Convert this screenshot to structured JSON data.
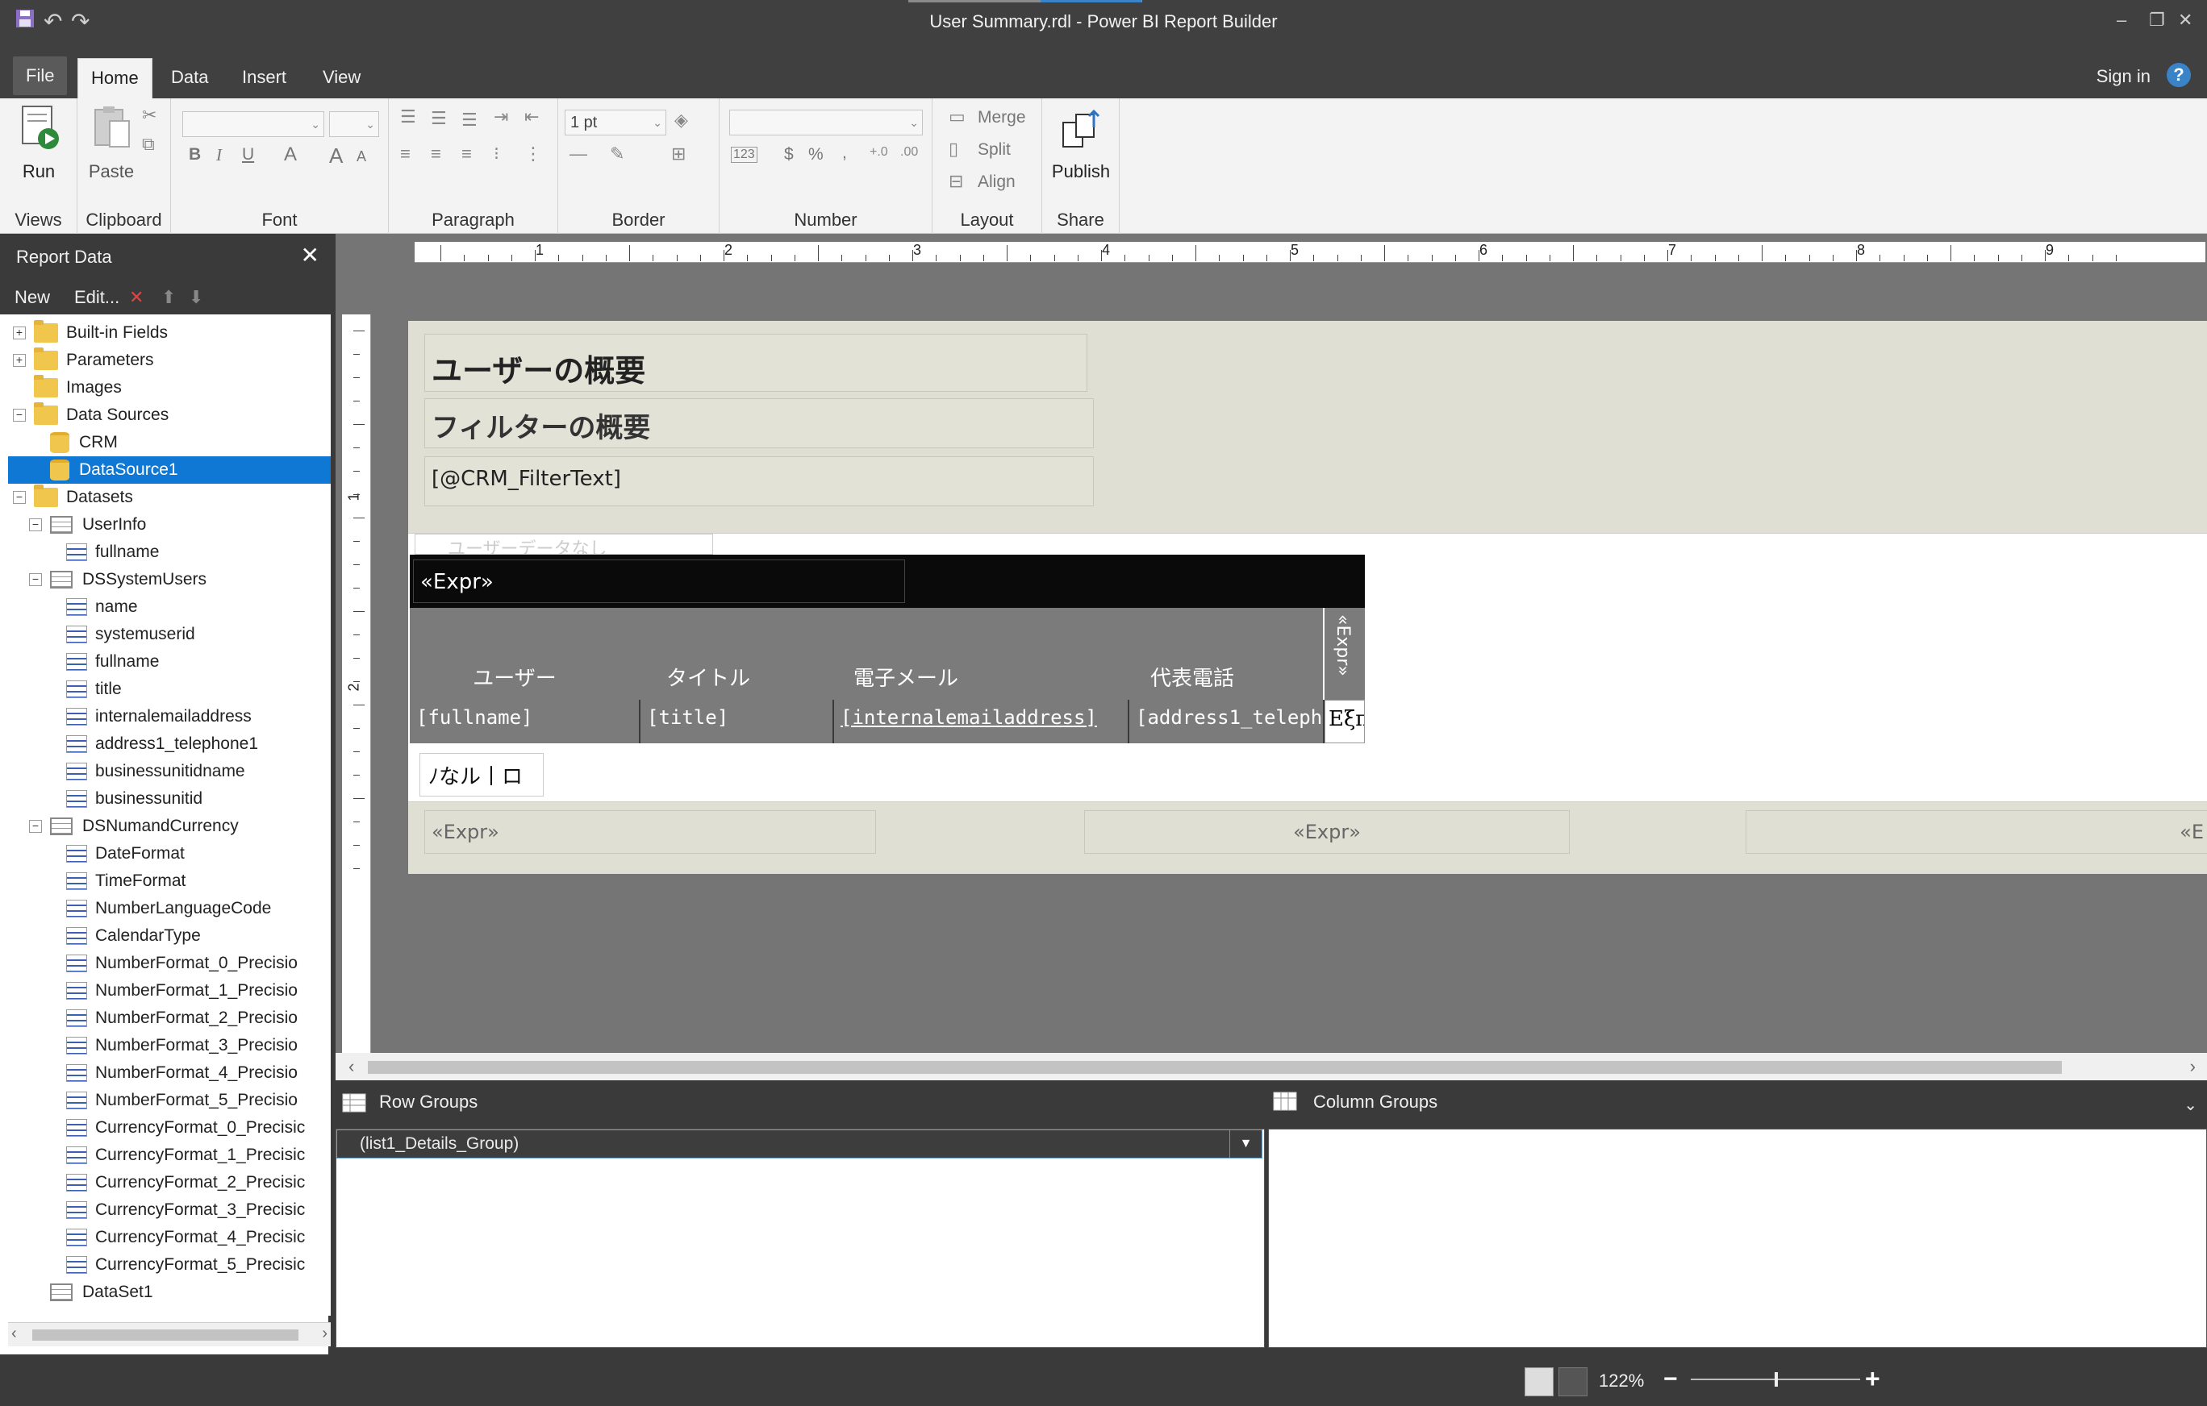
{
  "window": {
    "title": "User Summary.rdl - Power BI Report Builder",
    "minimize": "–",
    "restore": "❐",
    "close": "✕",
    "undo": "↶",
    "redo": "↷"
  },
  "ribbon_tabs": [
    "File",
    "Home",
    "Data",
    "Insert",
    "View"
  ],
  "signin": "Sign in",
  "help": "?",
  "ribbon": {
    "run": "Run",
    "paste": "Paste",
    "views": "Views",
    "clipboard": "Clipboard",
    "font": "Font",
    "paragraph": "Paragraph",
    "border": "Border",
    "number": "Number",
    "layout": "Layout",
    "share": "Share",
    "border_width": "1 pt",
    "merge": "Merge",
    "split": "Split",
    "align": "Align",
    "publish": "Publish",
    "bold": "B",
    "italic": "I",
    "underline": "U",
    "currency": "$",
    "percent": "%",
    "comma": ",",
    "grow": "A",
    "num_fmt": "123"
  },
  "report_data": {
    "title": "Report Data",
    "close": "✕",
    "toolbar": {
      "new": "New",
      "edit": "Edit...",
      "delete": "✕",
      "up": "⬆",
      "down": "⬇"
    },
    "tree": [
      {
        "label": "Built-in Fields",
        "icon": "folder-icon",
        "level": 0,
        "exp": "+"
      },
      {
        "label": "Parameters",
        "icon": "folder-icon",
        "level": 0,
        "exp": "+"
      },
      {
        "label": "Images",
        "icon": "folder-icon",
        "level": 0,
        "exp": ""
      },
      {
        "label": "Data Sources",
        "icon": "folder-open-icon",
        "level": 0,
        "exp": "−"
      },
      {
        "label": "CRM",
        "icon": "datasource-icon",
        "level": 1,
        "exp": ""
      },
      {
        "label": "DataSource1",
        "icon": "datasource-icon",
        "level": 1,
        "exp": "",
        "selected": true
      },
      {
        "label": "Datasets",
        "icon": "folder-open-icon",
        "level": 0,
        "exp": "−"
      },
      {
        "label": "UserInfo",
        "icon": "dataset-icon",
        "level": 1,
        "exp": "−"
      },
      {
        "label": "fullname",
        "icon": "field-icon",
        "level": 2,
        "exp": ""
      },
      {
        "label": "DSSystemUsers",
        "icon": "dataset-icon",
        "level": 1,
        "exp": "−"
      },
      {
        "label": "name",
        "icon": "field-icon",
        "level": 2,
        "exp": ""
      },
      {
        "label": "systemuserid",
        "icon": "field-icon",
        "level": 2,
        "exp": ""
      },
      {
        "label": "fullname",
        "icon": "field-icon",
        "level": 2,
        "exp": ""
      },
      {
        "label": "title",
        "icon": "field-icon",
        "level": 2,
        "exp": ""
      },
      {
        "label": "internalemailaddress",
        "icon": "field-icon",
        "level": 2,
        "exp": ""
      },
      {
        "label": "address1_telephone1",
        "icon": "field-icon",
        "level": 2,
        "exp": ""
      },
      {
        "label": "businessunitidname",
        "icon": "field-icon",
        "level": 2,
        "exp": ""
      },
      {
        "label": "businessunitid",
        "icon": "field-icon",
        "level": 2,
        "exp": ""
      },
      {
        "label": "DSNumandCurrency",
        "icon": "dataset-icon",
        "level": 1,
        "exp": "−"
      },
      {
        "label": "DateFormat",
        "icon": "field-icon",
        "level": 2,
        "exp": ""
      },
      {
        "label": "TimeFormat",
        "icon": "field-icon",
        "level": 2,
        "exp": ""
      },
      {
        "label": "NumberLanguageCode",
        "icon": "field-icon",
        "level": 2,
        "exp": ""
      },
      {
        "label": "CalendarType",
        "icon": "field-icon",
        "level": 2,
        "exp": ""
      },
      {
        "label": "NumberFormat_0_Precisio",
        "icon": "field-icon",
        "level": 2,
        "exp": ""
      },
      {
        "label": "NumberFormat_1_Precisio",
        "icon": "field-icon",
        "level": 2,
        "exp": ""
      },
      {
        "label": "NumberFormat_2_Precisio",
        "icon": "field-icon",
        "level": 2,
        "exp": ""
      },
      {
        "label": "NumberFormat_3_Precisio",
        "icon": "field-icon",
        "level": 2,
        "exp": ""
      },
      {
        "label": "NumberFormat_4_Precisio",
        "icon": "field-icon",
        "level": 2,
        "exp": ""
      },
      {
        "label": "NumberFormat_5_Precisio",
        "icon": "field-icon",
        "level": 2,
        "exp": ""
      },
      {
        "label": "CurrencyFormat_0_Precisic",
        "icon": "field-icon",
        "level": 2,
        "exp": ""
      },
      {
        "label": "CurrencyFormat_1_Precisic",
        "icon": "field-icon",
        "level": 2,
        "exp": ""
      },
      {
        "label": "CurrencyFormat_2_Precisic",
        "icon": "field-icon",
        "level": 2,
        "exp": ""
      },
      {
        "label": "CurrencyFormat_3_Precisic",
        "icon": "field-icon",
        "level": 2,
        "exp": ""
      },
      {
        "label": "CurrencyFormat_4_Precisic",
        "icon": "field-icon",
        "level": 2,
        "exp": ""
      },
      {
        "label": "CurrencyFormat_5_Precisic",
        "icon": "field-icon",
        "level": 2,
        "exp": ""
      },
      {
        "label": "DataSet1",
        "icon": "dataset-icon",
        "level": 1,
        "exp": ""
      }
    ]
  },
  "ruler": {
    "h_numbers": [
      "1",
      "2",
      "3",
      "4",
      "5",
      "6",
      "7",
      "8",
      "9"
    ],
    "v_numbers": [
      "1",
      "2"
    ]
  },
  "report": {
    "title": "ユーザーの概要",
    "filter_title": "フィルターの概要",
    "filter_text": "[@CRM_FilterText]",
    "hidden_text": "ユーザーデータなし",
    "list_expr": "«Expr»",
    "col_headers": [
      "ユーザー",
      "タイトル",
      "電子メール",
      "代表電話"
    ],
    "vertical_expr": "«Expr»",
    "detail_cells": [
      "[fullname]",
      "[title]",
      "[internalemailaddress]",
      "[address1_teleph"
    ],
    "detail_last": "Eξπ",
    "jp_text": "ﾉなル丨ロ",
    "footer_exprs": [
      "«Expr»",
      "«Expr»",
      "«E"
    ]
  },
  "groups": {
    "row_title": "Row Groups",
    "col_title": "Column Groups",
    "row_item": "(list1_Details_Group)"
  },
  "status": {
    "zoom": "122%",
    "minus": "−",
    "plus": "+"
  },
  "colors": {
    "accent": "#0f78d4",
    "chrome": "#3a3a3a",
    "ribbon": "#f3f3f3",
    "report_band": "#e0dfd4"
  }
}
